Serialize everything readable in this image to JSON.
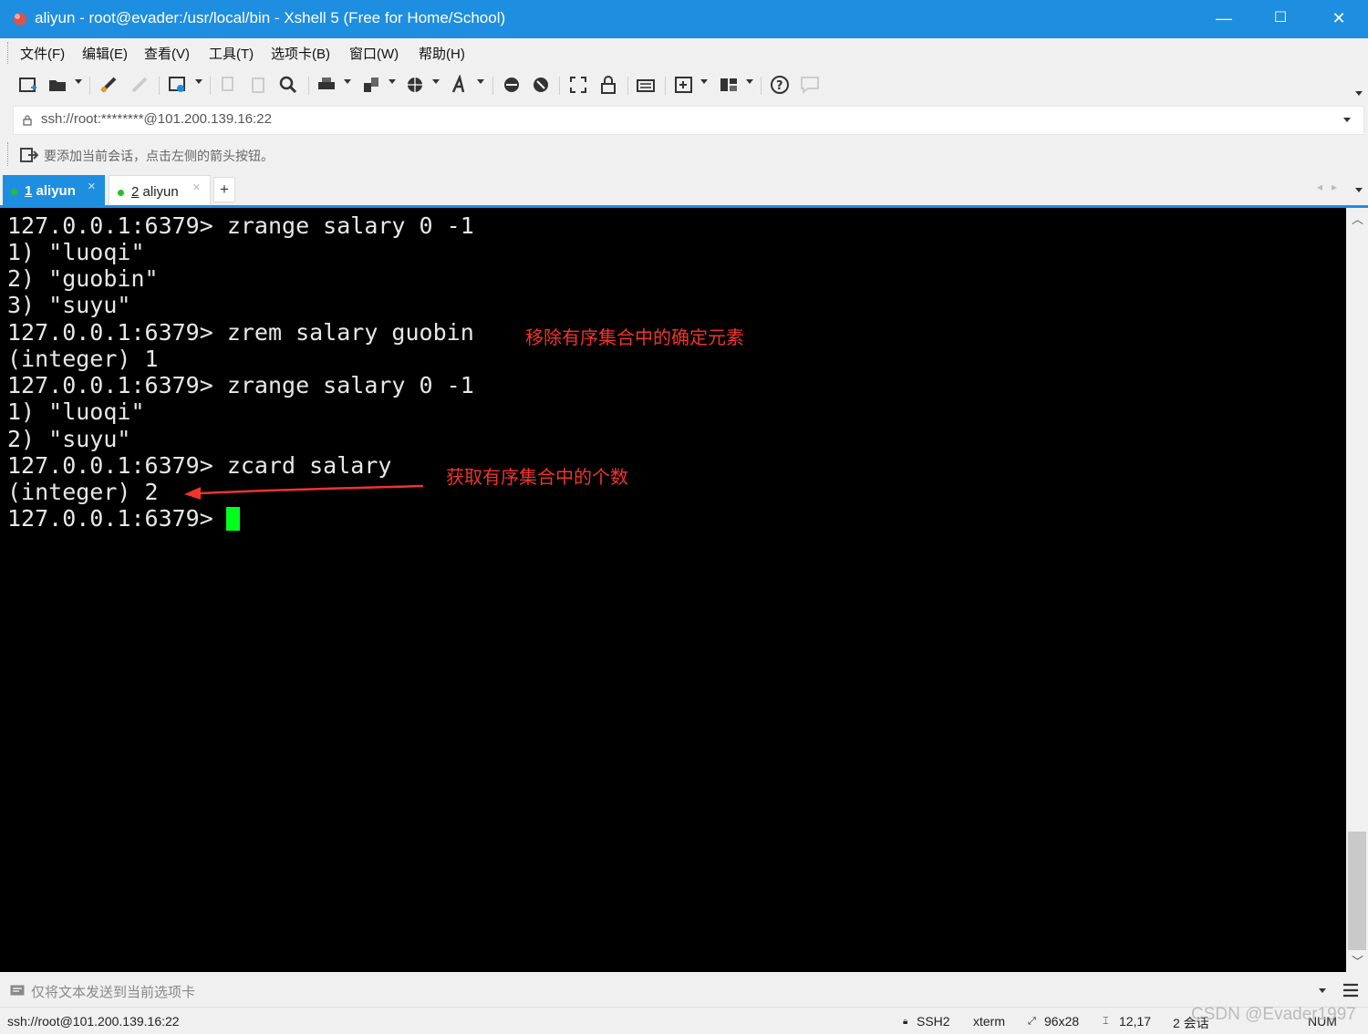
{
  "window": {
    "title": "aliyun - root@evader:/usr/local/bin - Xshell 5 (Free for Home/School)",
    "minimize": "—",
    "maximize": "☐",
    "close": "✕"
  },
  "menu": [
    "文件(F)",
    "编辑(E)",
    "查看(V)",
    "工具(T)",
    "选项卡(B)",
    "窗口(W)",
    "帮助(H)"
  ],
  "address": {
    "value": "ssh://root:********@101.200.139.16:22"
  },
  "hint": "要添加当前会话，点击左侧的箭头按钮。",
  "tabs": [
    {
      "num": "1",
      "name": "aliyun",
      "active": true
    },
    {
      "num": "2",
      "name": "aliyun",
      "active": false
    }
  ],
  "new_tab": "+",
  "terminal": {
    "lines": [
      "127.0.0.1:6379> zrange salary 0 -1",
      "1) \"luoqi\"",
      "2) \"guobin\"",
      "3) \"suyu\"",
      "127.0.0.1:6379> zrem salary guobin",
      "(integer) 1",
      "127.0.0.1:6379> zrange salary 0 -1",
      "1) \"luoqi\"",
      "2) \"suyu\"",
      "127.0.0.1:6379> zcard salary",
      "(integer) 2",
      "127.0.0.1:6379> "
    ],
    "annotations": [
      "移除有序集合中的确定元素",
      "获取有序集合中的个数"
    ],
    "cursor_color": "#00ff1a",
    "annotation_color": "#f0342c"
  },
  "sendbar": {
    "text": "仅将文本发送到当前选项卡"
  },
  "status": {
    "connection": "ssh://root@101.200.139.16:22",
    "protocol": "SSH2",
    "terminal": "xterm",
    "size": "96x28",
    "position": "12,17",
    "sessions": "2 会话",
    "numlock": "NUM"
  },
  "watermark": "CSDN @Evader1997",
  "colors": {
    "accent": "#1e8ee0",
    "terminal_bg": "#000000"
  }
}
